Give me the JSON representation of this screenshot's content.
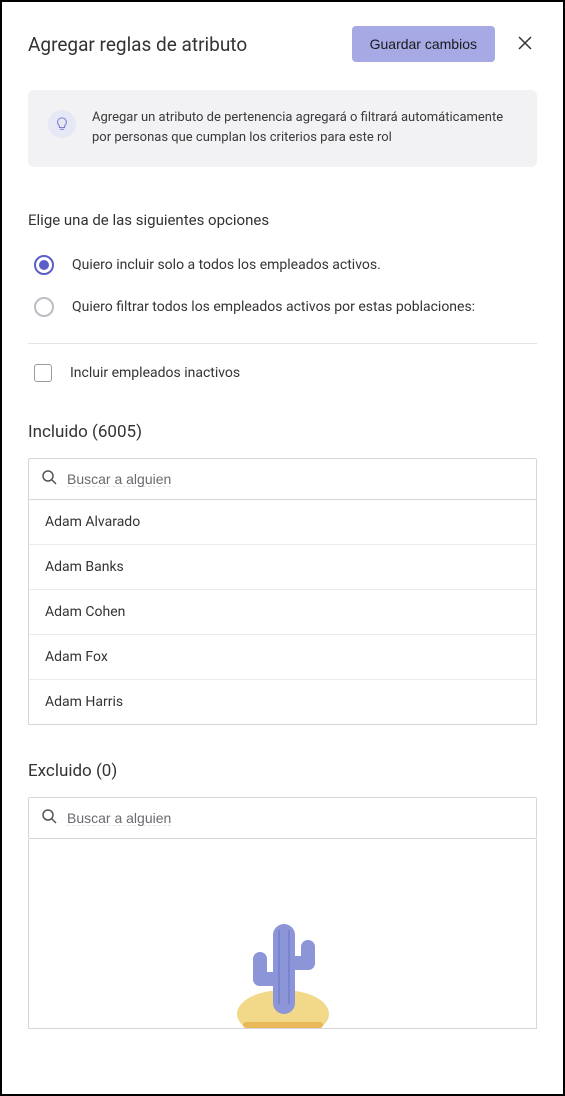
{
  "header": {
    "title": "Agregar reglas de atributo",
    "save_label": "Guardar cambios"
  },
  "info": {
    "text": "Agregar un atributo de pertenencia agregará o filtrará automáticamente por personas que cumplan los criterios para este rol"
  },
  "options": {
    "heading": "Elige una de las siguientes opciones",
    "radio1": "Quiero incluir solo a todos los empleados activos.",
    "radio2": "Quiero filtrar todos los empleados activos por estas poblaciones:",
    "checkbox": "Incluir empleados inactivos"
  },
  "included": {
    "title": "Incluido (6005)",
    "search_placeholder": "Buscar a alguien",
    "items": [
      "Adam Alvarado",
      "Adam Banks",
      "Adam Cohen",
      "Adam Fox",
      "Adam Harris"
    ]
  },
  "excluded": {
    "title": "Excluido (0)",
    "search_placeholder": "Buscar a alguien"
  }
}
